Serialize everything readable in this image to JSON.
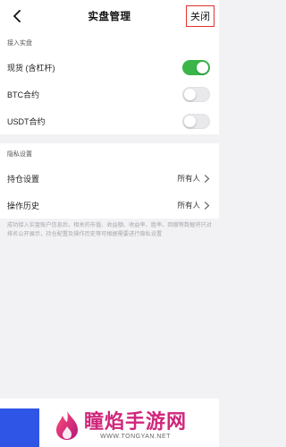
{
  "nav": {
    "title": "实盘管理",
    "close_label": "关闭"
  },
  "access_section": {
    "header": "接入实盘",
    "rows": [
      {
        "label": "现货 (含杠杆)",
        "enabled": true
      },
      {
        "label": "BTC合约",
        "enabled": false
      },
      {
        "label": "USDT合约",
        "enabled": false
      }
    ]
  },
  "privacy_section": {
    "header": "隐私设置",
    "rows": [
      {
        "label": "持仓设置",
        "value": "所有人"
      },
      {
        "label": "操作历史",
        "value": "所有人"
      }
    ]
  },
  "footnote": "成功接入实盘账户信息后，相关的市值、收益额、收益率、胜率、回撤等数据将只对排名公开展示，持仓配置及操作历史等可根据需要进行隐私设置",
  "watermark": {
    "cn": "瞳焰手游网",
    "en": "WWW.TONGYAN.NET"
  },
  "colors": {
    "toggle_on": "#3ab54a",
    "close_border": "#e0322d",
    "accent_blue": "#2f55e6",
    "watermark": "#d0267b"
  }
}
